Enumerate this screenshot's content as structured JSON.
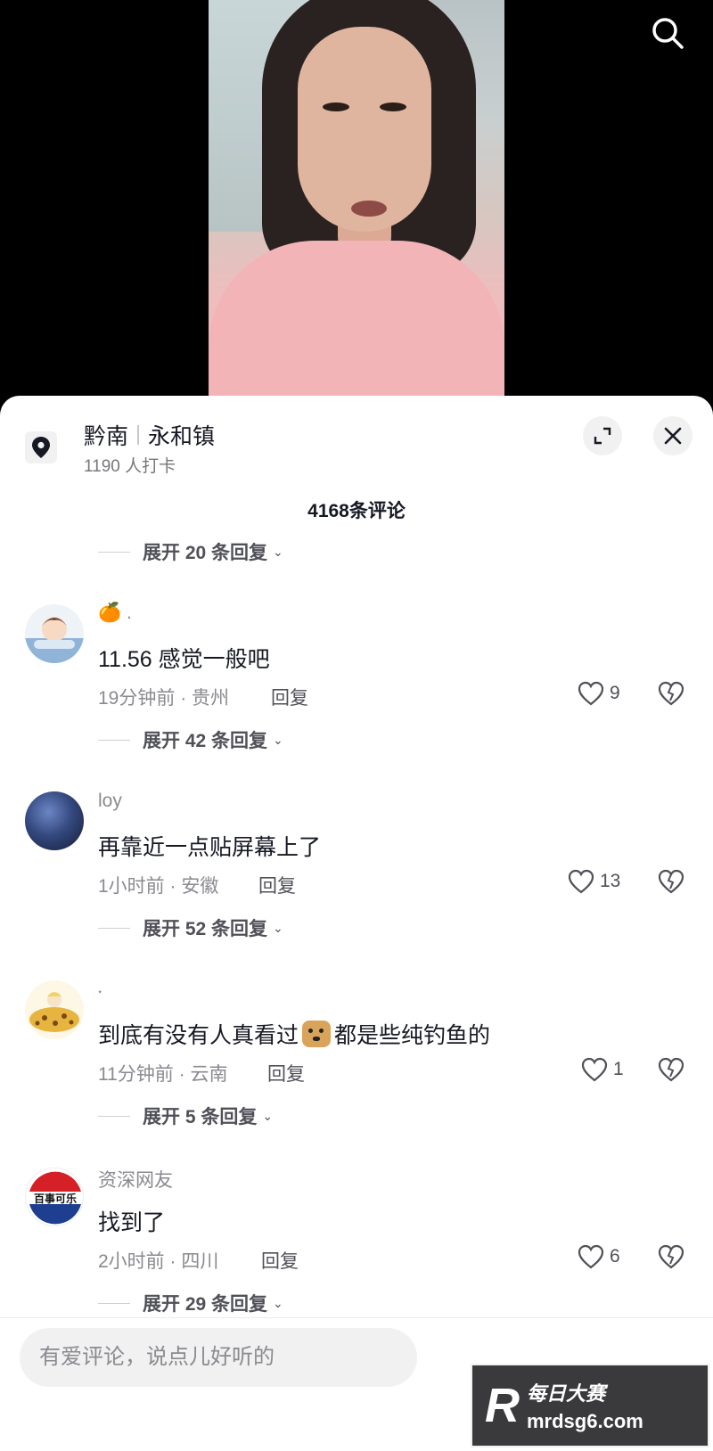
{
  "video": {
    "search_icon": "search-icon"
  },
  "location": {
    "region": "黔南",
    "town": "永和镇",
    "checkins": "1190 人打卡"
  },
  "header": {
    "expand_icon": "expand-icon",
    "close_icon": "close-icon"
  },
  "comments_count": "4168条评论",
  "top_expand": {
    "label": "展开 20 条回复"
  },
  "comments": [
    {
      "user": "🍊 .",
      "text": "11.56 感觉一般吧",
      "meta": "19分钟前 · 贵州",
      "reply": "回复",
      "likes": "9",
      "expand": "展开 42 条回复"
    },
    {
      "user": "loy",
      "text": "再靠近一点贴屏幕上了",
      "meta": "1小时前 · 安徽",
      "reply": "回复",
      "likes": "13",
      "expand": "展开 52 条回复"
    },
    {
      "user": "༌",
      "text_a": "到底有没有人真看过",
      "text_b": "都是些纯钓鱼的",
      "meta": "11分钟前 · 云南",
      "reply": "回复",
      "likes": "1",
      "expand": "展开 5 条回复"
    },
    {
      "user": "资深网友",
      "text": "找到了",
      "meta": "2小时前 · 四川",
      "reply": "回复",
      "likes": "6",
      "expand": "展开 29 条回复",
      "avatar_text": "百事可乐"
    }
  ],
  "input": {
    "placeholder": "有爱评论，说点儿好听的"
  },
  "watermark": {
    "line1": "每日大赛",
    "line2": "mrdsg6.com",
    "logo": "R"
  }
}
